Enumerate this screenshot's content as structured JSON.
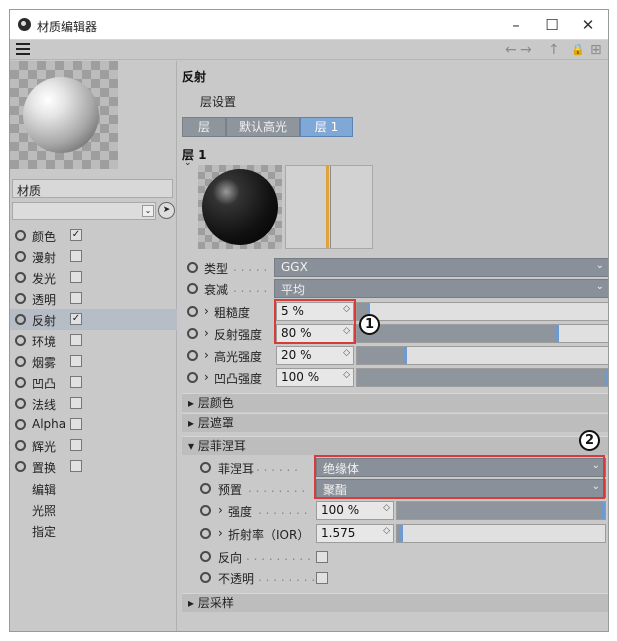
{
  "window": {
    "title": "材质编辑器",
    "controls": {
      "minimize": "–",
      "maximize": "☐",
      "close": "✕"
    }
  },
  "toolbar": {
    "back": "←",
    "forward": "→",
    "up": "↑",
    "lock": "🔒",
    "new": "⊞"
  },
  "material": {
    "name": "材质",
    "channels": [
      {
        "label": "颜色",
        "checked": true
      },
      {
        "label": "漫射",
        "checked": false
      },
      {
        "label": "发光",
        "checked": false
      },
      {
        "label": "透明",
        "checked": false
      },
      {
        "label": "反射",
        "checked": true
      },
      {
        "label": "环境",
        "checked": false
      },
      {
        "label": "烟雾",
        "checked": false
      },
      {
        "label": "凹凸",
        "checked": false
      },
      {
        "label": "法线",
        "checked": false
      },
      {
        "label": "Alpha",
        "checked": false
      },
      {
        "label": "辉光",
        "checked": false
      },
      {
        "label": "置换",
        "checked": false
      }
    ],
    "links": [
      "编辑",
      "光照",
      "指定"
    ]
  },
  "reflect": {
    "heading": "反射",
    "layer_settings": "层设置",
    "tabs": [
      {
        "label": "层"
      },
      {
        "label": "默认高光"
      },
      {
        "label": "层 1"
      }
    ],
    "layer_title": "层 1",
    "type": {
      "label": "类型",
      "value": "GGX"
    },
    "attenuation": {
      "label": "衰减",
      "value": "平均"
    },
    "roughness": {
      "label": "粗糙度",
      "value": "5 %",
      "level": 0.05
    },
    "reflect_strength": {
      "label": "反射强度",
      "value": "80 %",
      "level": 0.8
    },
    "spec_strength": {
      "label": "高光强度",
      "value": "20 %",
      "level": 0.2
    },
    "bump_strength": {
      "label": "凹凸强度",
      "value": "100 %",
      "level": 1.0
    },
    "sections": {
      "color": "层颜色",
      "mask": "层遮罩",
      "fresnel": "层菲涅耳",
      "sampling": "层采样"
    },
    "fresnel": {
      "fresnel": {
        "label": "菲涅耳",
        "value": "绝缘体"
      },
      "preset": {
        "label": "预置",
        "value": "聚酯"
      },
      "strength": {
        "label": "强度",
        "value": "100 %",
        "level": 1.0
      },
      "ior": {
        "label": "折射率（IOR）",
        "value": "1.575",
        "level": 0.03
      },
      "invert": {
        "label": "反向"
      },
      "opaque": {
        "label": "不透明"
      }
    }
  },
  "callouts": [
    "1",
    "2"
  ]
}
